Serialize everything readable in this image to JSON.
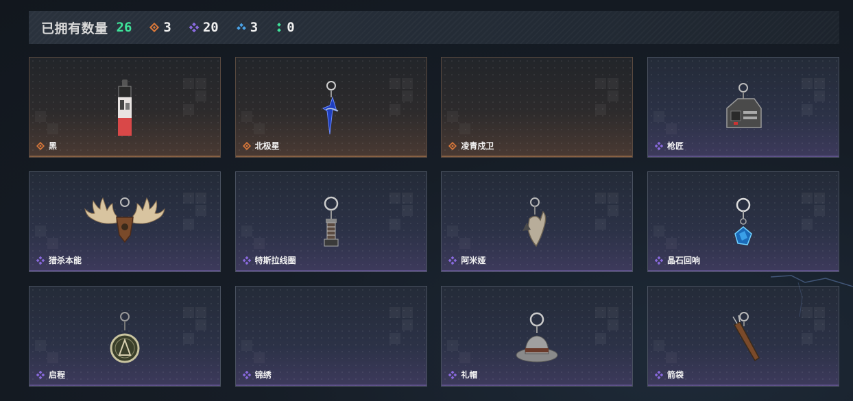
{
  "header": {
    "label": "已拥有数量",
    "total": "26",
    "stats": [
      {
        "icon": "orange-diamond-icon",
        "color": "#d9783a",
        "value": "3"
      },
      {
        "icon": "purple-diamond-icon",
        "color": "#8a6adf",
        "value": "20"
      },
      {
        "icon": "blue-diamond-icon",
        "color": "#4aa3e8",
        "value": "3"
      },
      {
        "icon": "green-dots-icon",
        "color": "#3fe39a",
        "value": "0"
      }
    ]
  },
  "items": [
    {
      "name": "黑",
      "rarity": "orange",
      "icon": "card-charm-icon"
    },
    {
      "name": "北极星",
      "rarity": "orange",
      "icon": "blue-star-charm-icon"
    },
    {
      "name": "凌青戍卫",
      "rarity": "orange",
      "icon": ""
    },
    {
      "name": "枪匠",
      "rarity": "purple",
      "icon": "toolbox-charm-icon"
    },
    {
      "name": "猎杀本能",
      "rarity": "purple",
      "icon": "antlers-charm-icon"
    },
    {
      "name": "特斯拉线圈",
      "rarity": "purple",
      "icon": "tesla-coil-charm-icon"
    },
    {
      "name": "阿米娅",
      "rarity": "purple",
      "icon": "ears-charm-icon"
    },
    {
      "name": "晶石回响",
      "rarity": "purple",
      "icon": "crystal-charm-icon"
    },
    {
      "name": "启程",
      "rarity": "purple",
      "icon": "medal-charm-icon"
    },
    {
      "name": "锦绣",
      "rarity": "purple",
      "icon": ""
    },
    {
      "name": "礼帽",
      "rarity": "purple",
      "icon": "hat-charm-icon"
    },
    {
      "name": "箭袋",
      "rarity": "purple",
      "icon": "quiver-charm-icon"
    }
  ],
  "colors": {
    "orange": "#d9783a",
    "purple": "#8a6adf",
    "accent_total": "#3fe39a"
  }
}
